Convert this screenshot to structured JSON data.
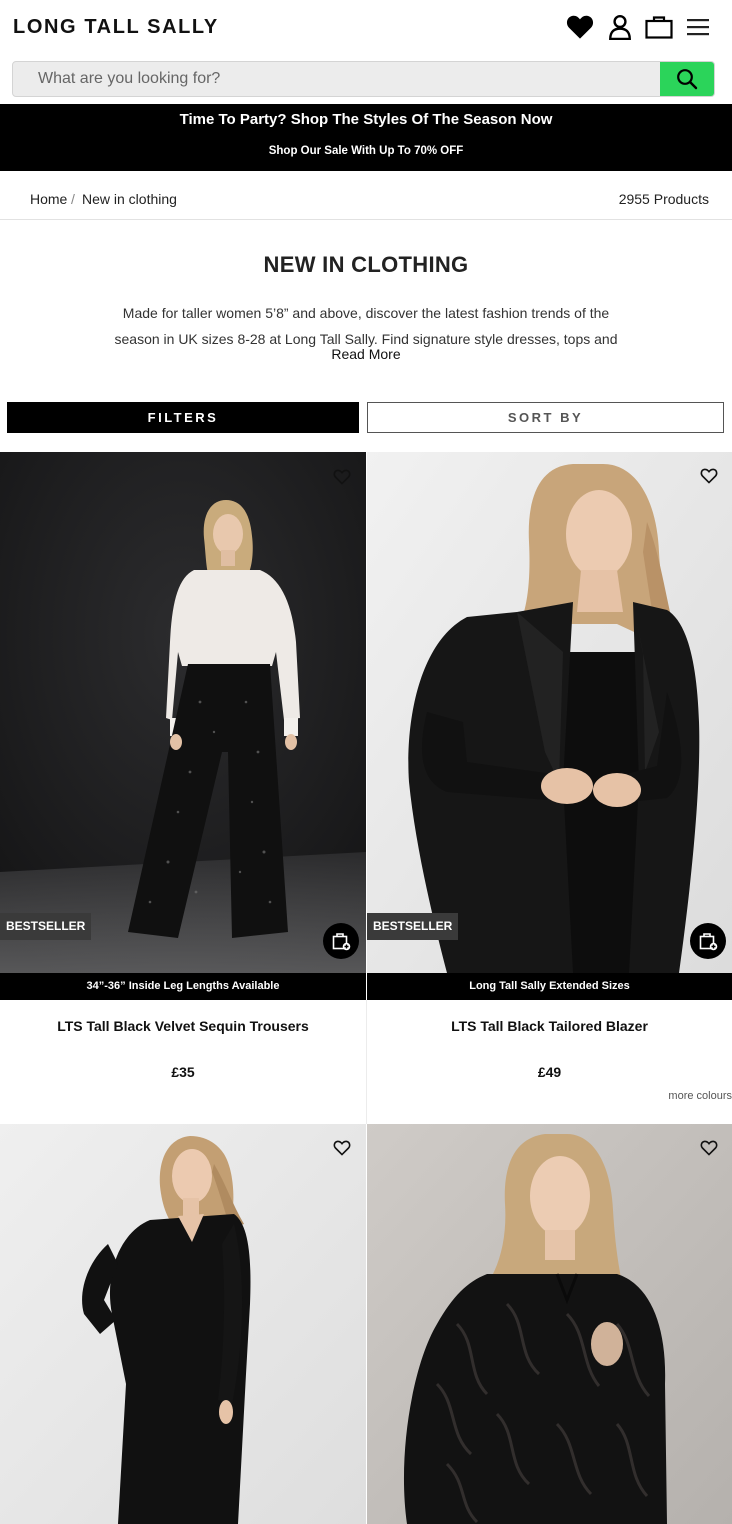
{
  "header": {
    "logo": "LONG TALL SALLY"
  },
  "search": {
    "placeholder": "What are you looking for?"
  },
  "promo": {
    "line1": "Time To Party? Shop The Styles Of The Season Now",
    "line2": "Shop Our Sale With Up To 70% OFF"
  },
  "breadcrumb": {
    "home": "Home",
    "separator": "/",
    "current": "New in clothing",
    "count": "2955 Products"
  },
  "intro": {
    "title": "NEW IN CLOTHING",
    "text": "Made for taller women 5’8” and above, discover the latest fashion trends of the season in UK sizes 8-28 at Long Tall Sally. Find signature style dresses, tops and",
    "read_more": "Read More"
  },
  "controls": {
    "filters": "FILTERS",
    "sort": "SORT BY"
  },
  "products": [
    {
      "badge": "BESTSELLER",
      "strip": "34”-36” Inside Leg Lengths Available",
      "name": "LTS Tall Black Velvet Sequin Trousers",
      "price": "£35"
    },
    {
      "badge": "BESTSELLER",
      "strip": "Long Tall Sally Extended Sizes",
      "name": "LTS Tall Black Tailored Blazer",
      "price": "£49",
      "more_colours": "more colours"
    }
  ],
  "colors": {
    "accent_green": "#2bd45a",
    "black": "#000000",
    "badge_grey": "#3a3a3a"
  }
}
